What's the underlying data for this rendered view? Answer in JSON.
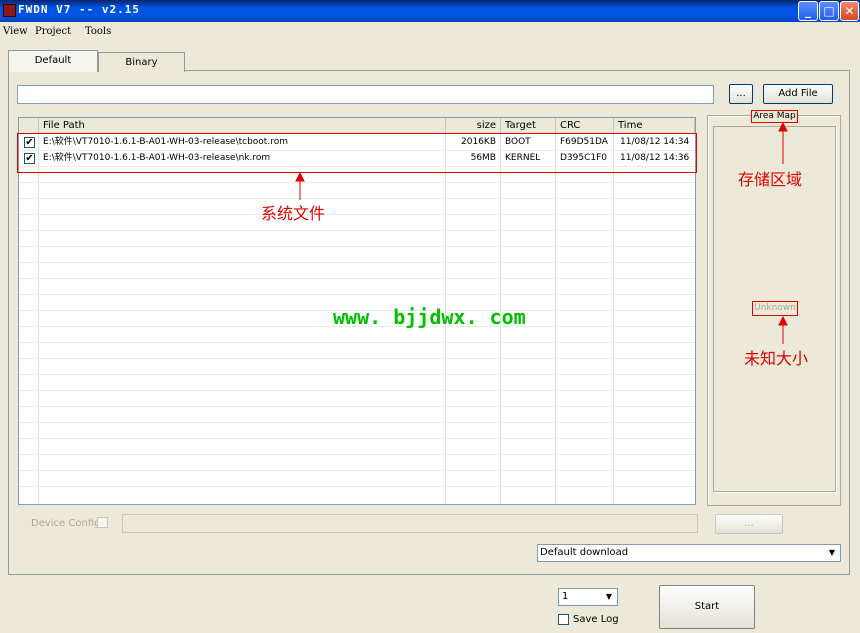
{
  "window": {
    "title": "FWDN V7 -- v2.15",
    "minimize_glyph": "_",
    "maximize_glyph": "□",
    "close_glyph": "✕"
  },
  "menu": [
    "View",
    "Project",
    "Tools"
  ],
  "tabs": [
    "Default",
    "Binary"
  ],
  "path_input": {
    "value": ""
  },
  "browse_label": "...",
  "add_file_label": "Add File",
  "list": {
    "columns": [
      "File Path",
      "size",
      "Target",
      "CRC",
      "Time"
    ],
    "rows": [
      {
        "checked": "✔",
        "path": "E:\\软件\\VT7010-1.6.1-B-A01-WH-03-release\\tcboot.rom",
        "size": "2016KB",
        "target": "BOOT",
        "crc": "F69D51DA",
        "time": "11/08/12 14:34"
      },
      {
        "checked": "✔",
        "path": "E:\\软件\\VT7010-1.6.1-B-A01-WH-03-release\\nk.rom",
        "size": "56MB",
        "target": "KERNEL",
        "crc": "D395C1F0",
        "time": "11/08/12 14:36"
      }
    ]
  },
  "area_map": {
    "label": "Area Map",
    "unknown_label": "Unknown"
  },
  "device_config": {
    "label": "Device Config",
    "value": "",
    "button_label": "..."
  },
  "download_mode": {
    "selected": "Default download"
  },
  "count_select": {
    "selected": "1"
  },
  "save_log_label": "Save Log",
  "start_label": "Start",
  "annotations": {
    "system_files": "系统文件",
    "storage_area": "存储区域",
    "unknown_size": "未知大小"
  },
  "watermark": "www. bjjdwx. com",
  "colors": {
    "annotation_red": "#e00000",
    "watermark_green": "#00c000",
    "titlebar_blue": "#0054e3"
  }
}
